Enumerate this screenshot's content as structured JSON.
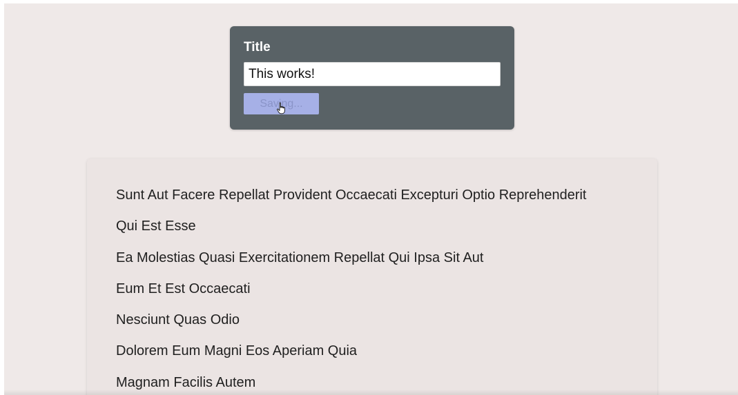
{
  "form": {
    "label": "Title",
    "input_value": "This works!",
    "button_label": "Saving..."
  },
  "posts": [
    "Sunt Aut Facere Repellat Provident Occaecati Excepturi Optio Reprehenderit",
    "Qui Est Esse",
    "Ea Molestias Quasi Exercitationem Repellat Qui Ipsa Sit Aut",
    "Eum Et Est Occaecati",
    "Nesciunt Quas Odio",
    "Dolorem Eum Magni Eos Aperiam Quia",
    "Magnam Facilis Autem"
  ],
  "colors": {
    "page_background": "#efe9e8",
    "form_background": "#596266",
    "button_disabled": "#a6b0e6",
    "list_background": "#ebe4e3"
  },
  "icons": {
    "cursor": "hand-pointer-icon"
  }
}
